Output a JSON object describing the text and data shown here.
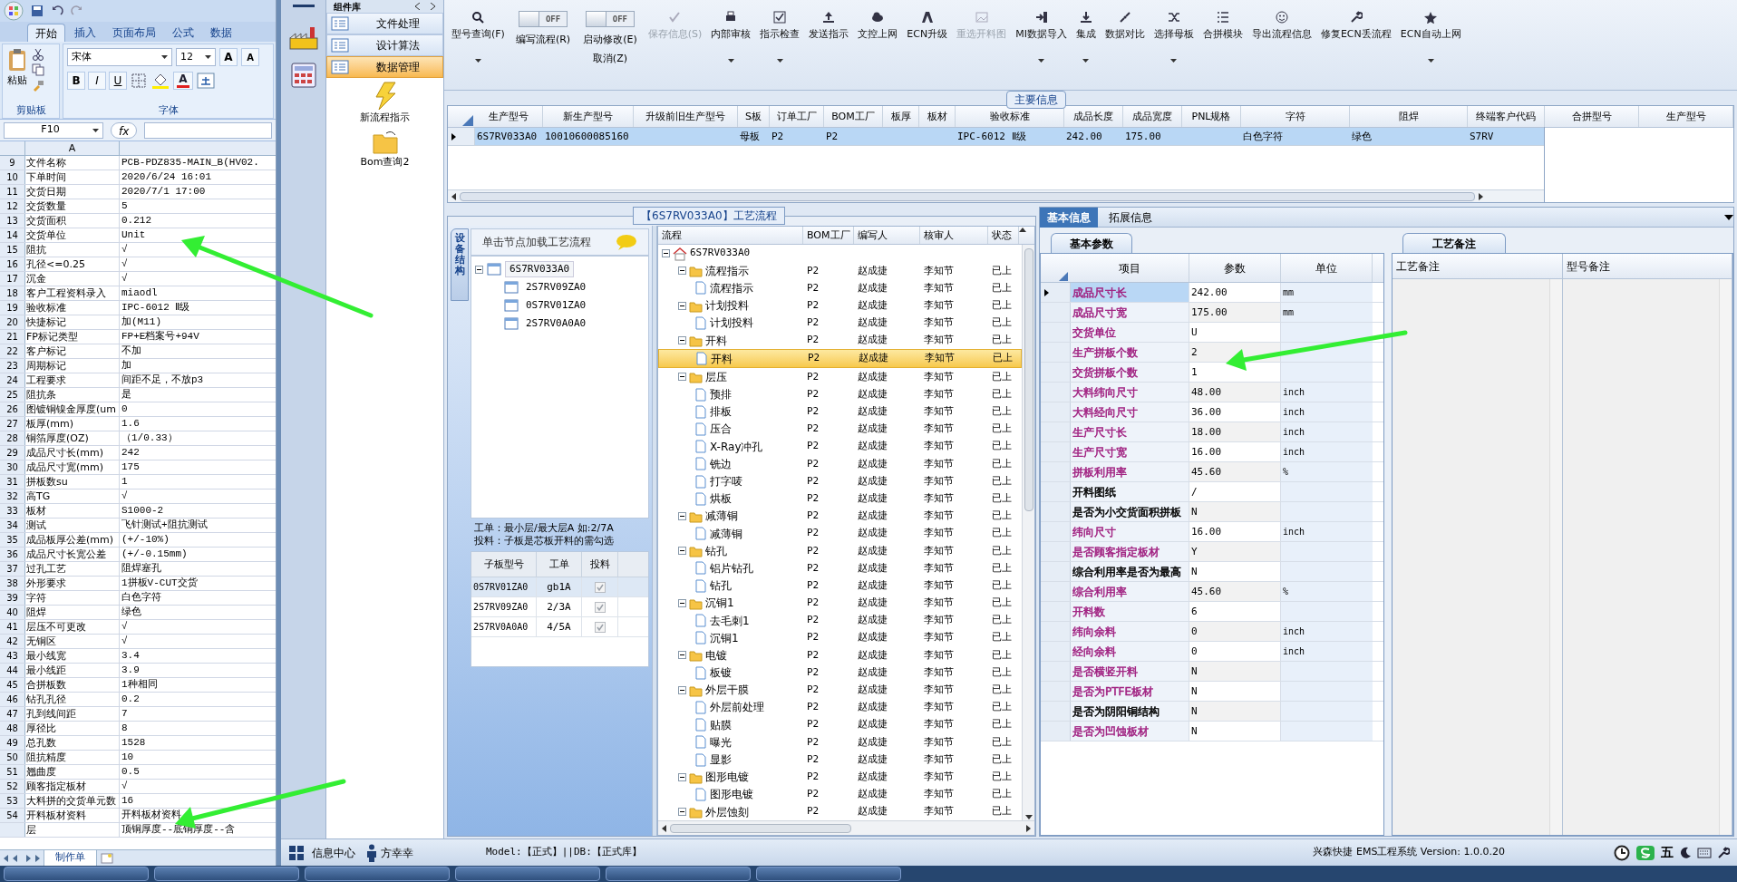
{
  "excel": {
    "tabs": [
      {
        "label": "开始",
        "selected": true
      },
      {
        "label": "插入",
        "selected": false
      },
      {
        "label": "页面布局",
        "selected": false
      },
      {
        "label": "公式",
        "selected": false
      },
      {
        "label": "数据",
        "selected": false
      }
    ],
    "clipboard": {
      "paste_label": "粘贴",
      "group_label": "剪贴板"
    },
    "font": {
      "family": "宋体",
      "size": "12",
      "grow": "A",
      "shrink": "A",
      "bold": "B",
      "italic": "I",
      "underline": "U",
      "color_letter": "A",
      "group_label": "字体"
    },
    "name_box": "F10",
    "fx": "fx",
    "column": "A",
    "rows": [
      [
        "9",
        "文件名称",
        "PCB-PDZ835-MAIN_B(HV02."
      ],
      [
        "10",
        "下单时间",
        "2020/6/24 16:01"
      ],
      [
        "11",
        "交货日期",
        "2020/7/1 17:00"
      ],
      [
        "12",
        "交货数量",
        "5"
      ],
      [
        "13",
        "交货面积",
        "0.212"
      ],
      [
        "14",
        "交货单位",
        "Unit"
      ],
      [
        "15",
        "阻抗",
        "√"
      ],
      [
        "16",
        "孔径<=0.25",
        "√"
      ],
      [
        "17",
        "沉金",
        "√"
      ],
      [
        "18",
        "客户工程资料录入",
        "miaodl"
      ],
      [
        "19",
        "验收标准",
        "IPC-6012 Ⅱ级"
      ],
      [
        "20",
        "快捷标记",
        "加(M11)"
      ],
      [
        "21",
        "FP标记类型",
        "FP+E档案号+94V"
      ],
      [
        "22",
        "客户标记",
        "不加"
      ],
      [
        "23",
        "周期标记",
        "加"
      ],
      [
        "24",
        "工程要求",
        "间距不足，不放p3"
      ],
      [
        "25",
        "阻抗条",
        "是"
      ],
      [
        "26",
        "图镀铜镍金厚度(um",
        "0"
      ],
      [
        "27",
        "板厚(mm)",
        "1.6"
      ],
      [
        "28",
        "铜箔厚度(OZ)",
        "（1/0.33）"
      ],
      [
        "29",
        "成品尺寸长(mm)",
        "242"
      ],
      [
        "30",
        "成品尺寸宽(mm)",
        "175"
      ],
      [
        "31",
        "拼板数su",
        "1"
      ],
      [
        "32",
        "高TG",
        "√"
      ],
      [
        "33",
        "板材",
        "S1000-2"
      ],
      [
        "34",
        "测试",
        "飞针测试+阻抗测试"
      ],
      [
        "35",
        "成品板厚公差(mm)",
        "(+/-10%)"
      ],
      [
        "36",
        "成品尺寸长宽公差",
        "(+/-0.15mm)"
      ],
      [
        "37",
        "过孔工艺",
        "阻焊塞孔"
      ],
      [
        "38",
        "外形要求",
        "1拼板V-CUT交货"
      ],
      [
        "39",
        "字符",
        "白色字符"
      ],
      [
        "40",
        "阻焊",
        "绿色"
      ],
      [
        "41",
        "层压不可更改",
        "√"
      ],
      [
        "42",
        "无铜区",
        "√"
      ],
      [
        "43",
        "最小线宽",
        "3.4"
      ],
      [
        "44",
        "最小线距",
        "3.9"
      ],
      [
        "45",
        "合拼板数",
        "1种相同"
      ],
      [
        "46",
        "钻孔孔径",
        "0.2"
      ],
      [
        "47",
        "孔到线间距",
        "7"
      ],
      [
        "48",
        "厚径比",
        "8"
      ],
      [
        "49",
        "总孔数",
        "1528"
      ],
      [
        "50",
        "阻抗精度",
        "10"
      ],
      [
        "51",
        "翘曲度",
        "0.5"
      ],
      [
        "52",
        "顾客指定板材",
        "√"
      ],
      [
        "53",
        "大料拼的交货单元数",
        "16"
      ],
      [
        "54",
        "开料板材资料",
        "开料板材资料"
      ],
      [
        null,
        "层",
        "顶铜厚度--底铜厚度--含"
      ]
    ],
    "sheet_tab": "制作单"
  },
  "nav": {
    "header": "组件库",
    "items": [
      {
        "label": "文件处理",
        "selected": false
      },
      {
        "label": "设计算法",
        "selected": false
      },
      {
        "label": "数据管理",
        "selected": true
      }
    ],
    "tools": [
      "新流程指示",
      "Bom查询2"
    ]
  },
  "toolbar": [
    {
      "kind": "button",
      "label": "型号查询(F)",
      "dropdown": true,
      "disabled": false
    },
    {
      "kind": "toggle",
      "toggle_text": "OFF",
      "on": false,
      "label": "编写流程(R)"
    },
    {
      "kind": "toggle",
      "toggle_text": "OFF",
      "on": false,
      "label": "启动修改(E)",
      "sublabel": "取消(Z)"
    },
    {
      "kind": "button",
      "label": "保存信息(S)",
      "dropdown": false,
      "disabled": true
    },
    {
      "kind": "button",
      "label": "内部审核",
      "dropdown": true,
      "disabled": false
    },
    {
      "kind": "button",
      "label": "指示检查",
      "dropdown": true,
      "disabled": false
    },
    {
      "kind": "button",
      "label": "发送指示",
      "dropdown": false,
      "disabled": false
    },
    {
      "kind": "button",
      "label": "文控上网",
      "dropdown": false,
      "disabled": false
    },
    {
      "kind": "button",
      "label": "ECN升级",
      "dropdown": false,
      "disabled": false
    },
    {
      "kind": "button",
      "label": "重选开料图",
      "dropdown": false,
      "disabled": true
    },
    {
      "kind": "button",
      "label": "MI数据导入",
      "dropdown": true,
      "disabled": false
    },
    {
      "kind": "button",
      "label": "集成",
      "dropdown": true,
      "disabled": false
    },
    {
      "kind": "button",
      "label": "数据对比",
      "dropdown": false,
      "disabled": false
    },
    {
      "kind": "button",
      "label": "选择母板",
      "dropdown": true,
      "disabled": false
    },
    {
      "kind": "button",
      "label": "合拼模块",
      "dropdown": false,
      "disabled": false
    },
    {
      "kind": "button",
      "label": "导出流程信息",
      "dropdown": false,
      "disabled": false
    },
    {
      "kind": "button",
      "label": "修复ECN丢流程",
      "dropdown": false,
      "disabled": false
    },
    {
      "kind": "button",
      "label": "ECN自动上网",
      "dropdown": true,
      "disabled": false
    }
  ],
  "main_info": {
    "title": "主要信息",
    "columns": [
      "生产型号",
      "新生产型号",
      "升级前旧生产型号",
      "S板",
      "订单工厂",
      "BOM工厂",
      "板厚",
      "板材",
      "验收标准",
      "成品长度",
      "成品宽度",
      "PNL规格",
      "字符",
      "阻焊",
      "终端客户代码"
    ],
    "rows": [
      {
        "selected": true,
        "cells": [
          "6S7RV033A0",
          "10010600085160",
          null,
          "母板",
          "P2",
          "P2",
          null,
          null,
          "IPC-6012 Ⅱ级",
          "242.00",
          "175.00",
          null,
          "白色字符",
          "绿色",
          "S7RV"
        ]
      }
    ],
    "side_columns": [
      "合拼型号",
      "生产型号"
    ]
  },
  "process": {
    "title": "【6S7RV033A0】工艺流程",
    "side_tab": "设备结构",
    "hint": "单击节点加载工艺流程",
    "boards": {
      "label": "6S7RV033A0",
      "expanded": true,
      "selected": true,
      "children": [
        {
          "label": "2S7RV09ZA0",
          "selected": false
        },
        {
          "label": "0S7RV01ZA0",
          "selected": false
        },
        {
          "label": "2S7RV0A0A0",
          "selected": false
        }
      ]
    },
    "notes": [
      "工单：最小层/最大层A 如:2/7A",
      "投料：子板是芯板开料的需勾选"
    ],
    "sub_columns": [
      "子板型号",
      "工单",
      "投料"
    ],
    "sub_rows": [
      {
        "board": "0S7RV01ZA0",
        "order": "gb1A",
        "checked": true,
        "selected": true
      },
      {
        "board": "2S7RV09ZA0",
        "order": "2/3A",
        "checked": true,
        "selected": false
      },
      {
        "board": "2S7RV0A0A0",
        "order": "4/5A",
        "checked": true,
        "selected": false
      }
    ],
    "flow_columns": [
      "流程",
      "BOM工厂",
      "编写人",
      "核审人",
      "状态"
    ],
    "flow": {
      "label": "6S7RV033A0",
      "expanded": true,
      "children": [
        {
          "label": "流程指示",
          "bom": "P2",
          "writer": "赵成捷",
          "reviewer": "李知节",
          "status": "已上",
          "expanded": true,
          "selected": false,
          "children": [
            {
              "label": "流程指示",
              "bom": "P2",
              "writer": "赵成捷",
              "reviewer": "李知节",
              "status": "已上",
              "selected": false
            }
          ]
        },
        {
          "label": "计划投料",
          "bom": "P2",
          "writer": "赵成捷",
          "reviewer": "李知节",
          "status": "已上",
          "expanded": true,
          "selected": false,
          "children": [
            {
              "label": "计划投料",
              "bom": "P2",
              "writer": "赵成捷",
              "reviewer": "李知节",
              "status": "已上",
              "selected": false
            }
          ]
        },
        {
          "label": "开料",
          "bom": "P2",
          "writer": "赵成捷",
          "reviewer": "李知节",
          "status": "已上",
          "expanded": true,
          "selected": false,
          "children": [
            {
              "label": "开料",
              "bom": "P2",
              "writer": "赵成捷",
              "reviewer": "李知节",
              "status": "已上",
              "selected": true
            }
          ]
        },
        {
          "label": "层压",
          "bom": "P2",
          "writer": "赵成捷",
          "reviewer": "李知节",
          "status": "已上",
          "expanded": true,
          "selected": false,
          "children": [
            {
              "label": "预排",
              "bom": "P2",
              "writer": "赵成捷",
              "reviewer": "李知节",
              "status": "已上",
              "selected": false
            },
            {
              "label": "排板",
              "bom": "P2",
              "writer": "赵成捷",
              "reviewer": "李知节",
              "status": "已上",
              "selected": false
            },
            {
              "label": "压合",
              "bom": "P2",
              "writer": "赵成捷",
              "reviewer": "李知节",
              "status": "已上",
              "selected": false
            },
            {
              "label": "X-Ray冲孔",
              "bom": "P2",
              "writer": "赵成捷",
              "reviewer": "李知节",
              "status": "已上",
              "selected": false
            },
            {
              "label": "铣边",
              "bom": "P2",
              "writer": "赵成捷",
              "reviewer": "李知节",
              "status": "已上",
              "selected": false
            },
            {
              "label": "打字唛",
              "bom": "P2",
              "writer": "赵成捷",
              "reviewer": "李知节",
              "status": "已上",
              "selected": false
            },
            {
              "label": "烘板",
              "bom": "P2",
              "writer": "赵成捷",
              "reviewer": "李知节",
              "status": "已上",
              "selected": false
            }
          ]
        },
        {
          "label": "减薄铜",
          "bom": "P2",
          "writer": "赵成捷",
          "reviewer": "李知节",
          "status": "已上",
          "expanded": true,
          "selected": false,
          "children": [
            {
              "label": "减薄铜",
              "bom": "P2",
              "writer": "赵成捷",
              "reviewer": "李知节",
              "status": "已上",
              "selected": false
            }
          ]
        },
        {
          "label": "钻孔",
          "bom": "P2",
          "writer": "赵成捷",
          "reviewer": "李知节",
          "status": "已上",
          "expanded": true,
          "selected": false,
          "children": [
            {
              "label": "铝片钻孔",
              "bom": "P2",
              "writer": "赵成捷",
              "reviewer": "李知节",
              "status": "已上",
              "selected": false
            },
            {
              "label": "钻孔",
              "bom": "P2",
              "writer": "赵成捷",
              "reviewer": "李知节",
              "status": "已上",
              "selected": false
            }
          ]
        },
        {
          "label": "沉铜1",
          "bom": "P2",
          "writer": "赵成捷",
          "reviewer": "李知节",
          "status": "已上",
          "expanded": true,
          "selected": false,
          "children": [
            {
              "label": "去毛刺1",
              "bom": "P2",
              "writer": "赵成捷",
              "reviewer": "李知节",
              "status": "已上",
              "selected": false
            },
            {
              "label": "沉铜1",
              "bom": "P2",
              "writer": "赵成捷",
              "reviewer": "李知节",
              "status": "已上",
              "selected": false
            }
          ]
        },
        {
          "label": "电镀",
          "bom": "P2",
          "writer": "赵成捷",
          "reviewer": "李知节",
          "status": "已上",
          "expanded": true,
          "selected": false,
          "children": [
            {
              "label": "板镀",
              "bom": "P2",
              "writer": "赵成捷",
              "reviewer": "李知节",
              "status": "已上",
              "selected": false
            }
          ]
        },
        {
          "label": "外层干膜",
          "bom": "P2",
          "writer": "赵成捷",
          "reviewer": "李知节",
          "status": "已上",
          "expanded": true,
          "selected": false,
          "children": [
            {
              "label": "外层前处理",
              "bom": "P2",
              "writer": "赵成捷",
              "reviewer": "李知节",
              "status": "已上",
              "selected": false
            },
            {
              "label": "贴膜",
              "bom": "P2",
              "writer": "赵成捷",
              "reviewer": "李知节",
              "status": "已上",
              "selected": false
            },
            {
              "label": "曝光",
              "bom": "P2",
              "writer": "赵成捷",
              "reviewer": "李知节",
              "status": "已上",
              "selected": false
            },
            {
              "label": "显影",
              "bom": "P2",
              "writer": "赵成捷",
              "reviewer": "李知节",
              "status": "已上",
              "selected": false
            }
          ]
        },
        {
          "label": "图形电镀",
          "bom": "P2",
          "writer": "赵成捷",
          "reviewer": "李知节",
          "status": "已上",
          "expanded": true,
          "selected": false,
          "children": [
            {
              "label": "图形电镀",
              "bom": "P2",
              "writer": "赵成捷",
              "reviewer": "李知节",
              "status": "已上",
              "selected": false
            }
          ]
        },
        {
          "label": "外层蚀刻",
          "bom": "P2",
          "writer": "赵成捷",
          "reviewer": "李知节",
          "status": "已上",
          "expanded": true,
          "selected": false
        }
      ]
    }
  },
  "details": {
    "tabs": [
      {
        "label": "基本信息",
        "selected": true
      },
      {
        "label": "拓展信息",
        "selected": false
      }
    ],
    "sub_tab": "基本参数",
    "columns": [
      "项目",
      "参数",
      "单位"
    ],
    "rows": [
      {
        "item": "成品尺寸长",
        "value": "242.00",
        "unit": "mm",
        "color": "#a02080",
        "selected": true
      },
      {
        "item": "成品尺寸宽",
        "value": "175.00",
        "unit": "mm",
        "color": "#a02080",
        "selected": false
      },
      {
        "item": "交货单位",
        "value": "U",
        "color": "#a02080",
        "selected": false
      },
      {
        "item": "生产拼板个数",
        "value": "2",
        "color": "#a02080",
        "selected": false
      },
      {
        "item": "交货拼板个数",
        "value": "1",
        "color": "#a02080",
        "selected": false
      },
      {
        "item": "大料纬向尺寸",
        "value": "48.00",
        "unit": "inch",
        "color": "#a02080",
        "selected": false
      },
      {
        "item": "大料经向尺寸",
        "value": "36.00",
        "unit": "inch",
        "color": "#a02080",
        "selected": false
      },
      {
        "item": "生产尺寸长",
        "value": "18.00",
        "unit": "inch",
        "color": "#a02080",
        "selected": false
      },
      {
        "item": "生产尺寸宽",
        "value": "16.00",
        "unit": "inch",
        "color": "#a02080",
        "selected": false
      },
      {
        "item": "拼板利用率",
        "value": "45.60",
        "unit": "%",
        "color": "#a02080",
        "selected": false
      },
      {
        "item": "开料图纸",
        "value": "/",
        "color": "#000000",
        "selected": false
      },
      {
        "item": "是否为小交货面积拼板",
        "value": "N",
        "color": "#000000",
        "selected": false
      },
      {
        "item": "纬向尺寸",
        "value": "16.00",
        "unit": "inch",
        "color": "#a02080",
        "selected": false
      },
      {
        "item": "是否顾客指定板材",
        "value": "Y",
        "color": "#a02080",
        "selected": false
      },
      {
        "item": "综合利用率是否为最高",
        "value": "N",
        "color": "#000000",
        "selected": false
      },
      {
        "item": "综合利用率",
        "value": "45.60",
        "unit": "%",
        "color": "#a02080",
        "selected": false
      },
      {
        "item": "开料数",
        "value": "6",
        "color": "#a02080",
        "selected": false
      },
      {
        "item": "纬向余料",
        "value": "0",
        "unit": "inch",
        "color": "#a02080",
        "selected": false
      },
      {
        "item": "经向余料",
        "value": "0",
        "unit": "inch",
        "color": "#a02080",
        "selected": false
      },
      {
        "item": "是否横竖开料",
        "value": "N",
        "color": "#a02080",
        "selected": false
      },
      {
        "item": "是否为PTFE板材",
        "value": "N",
        "color": "#a02080",
        "selected": false
      },
      {
        "item": "是否为阴阳铜结构",
        "value": "N",
        "color": "#000000",
        "selected": false
      },
      {
        "item": "是否为凹蚀板材",
        "value": "N",
        "color": "#a02080",
        "selected": false
      }
    ],
    "notes_tab": "工艺备注",
    "notes_columns": [
      "工艺备注",
      "型号备注"
    ]
  },
  "status_bar": {
    "user_menu": "信息中心",
    "user": "方幸幸",
    "model": "Model:【正式】||DB:【正式库】",
    "product": "兴森快捷 EMS工程系统 Version: 1.0.0.20",
    "ime": "五"
  }
}
